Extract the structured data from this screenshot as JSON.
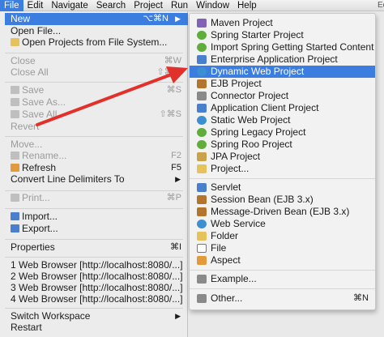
{
  "menubar": {
    "items": [
      "File",
      "Edit",
      "Navigate",
      "Search",
      "Project",
      "Run",
      "Window",
      "Help"
    ],
    "right_fragment": "Ec"
  },
  "file_menu": {
    "new": {
      "label": "New",
      "shortcut": "⌥⌘N"
    },
    "open_file": {
      "label": "Open File..."
    },
    "open_projects": {
      "label": "Open Projects from File System..."
    },
    "close": {
      "label": "Close",
      "shortcut": "⌘W"
    },
    "close_all": {
      "label": "Close All",
      "shortcut": "⇧⌘W"
    },
    "save": {
      "label": "Save",
      "shortcut": "⌘S"
    },
    "save_as": {
      "label": "Save As..."
    },
    "save_all": {
      "label": "Save All",
      "shortcut": "⇧⌘S"
    },
    "revert": {
      "label": "Revert"
    },
    "move": {
      "label": "Move..."
    },
    "rename": {
      "label": "Rename...",
      "shortcut": "F2"
    },
    "refresh": {
      "label": "Refresh",
      "shortcut": "F5"
    },
    "convert": {
      "label": "Convert Line Delimiters To"
    },
    "print": {
      "label": "Print...",
      "shortcut": "⌘P"
    },
    "import": {
      "label": "Import..."
    },
    "export": {
      "label": "Export..."
    },
    "properties": {
      "label": "Properties",
      "shortcut": "⌘I"
    },
    "recent": [
      "1 Web Browser  [http://localhost:8080/...]",
      "2 Web Browser  [http://localhost:8080/...]",
      "3 Web Browser  [http://localhost:8080/...]",
      "4 Web Browser  [http://localhost:8080/...]"
    ],
    "switch_workspace": {
      "label": "Switch Workspace"
    },
    "restart": {
      "label": "Restart"
    }
  },
  "new_submenu": {
    "items": [
      {
        "label": "Maven Project",
        "icon": "maven-icon"
      },
      {
        "label": "Spring Starter Project",
        "icon": "spring-icon"
      },
      {
        "label": "Import Spring Getting Started Content",
        "icon": "spring-import-icon"
      },
      {
        "label": "Enterprise Application Project",
        "icon": "enterprise-icon"
      },
      {
        "label": "Dynamic Web Project",
        "icon": "globe-icon"
      },
      {
        "label": "EJB Project",
        "icon": "ejb-icon"
      },
      {
        "label": "Connector Project",
        "icon": "connector-icon"
      },
      {
        "label": "Application Client Project",
        "icon": "app-client-icon"
      },
      {
        "label": "Static Web Project",
        "icon": "globe-icon"
      },
      {
        "label": "Spring Legacy Project",
        "icon": "spring-icon"
      },
      {
        "label": "Spring Roo Project",
        "icon": "roo-icon"
      },
      {
        "label": "JPA Project",
        "icon": "jpa-icon"
      },
      {
        "label": "Project...",
        "icon": "project-icon"
      },
      {
        "label": "Servlet",
        "icon": "servlet-icon"
      },
      {
        "label": "Session Bean (EJB 3.x)",
        "icon": "bean-icon"
      },
      {
        "label": "Message-Driven Bean (EJB 3.x)",
        "icon": "bean-icon"
      },
      {
        "label": "Web Service",
        "icon": "web-service-icon"
      },
      {
        "label": "Folder",
        "icon": "folder-icon"
      },
      {
        "label": "File",
        "icon": "file-icon"
      },
      {
        "label": "Aspect",
        "icon": "aspect-icon"
      },
      {
        "label": "Example...",
        "icon": "example-icon"
      },
      {
        "label": "Other...",
        "icon": "other-icon",
        "shortcut": "⌘N"
      }
    ],
    "highlighted": "Dynamic Web Project"
  },
  "colors": {
    "highlight": "#3b7ee0",
    "annotation_arrow": "#e2312a"
  }
}
